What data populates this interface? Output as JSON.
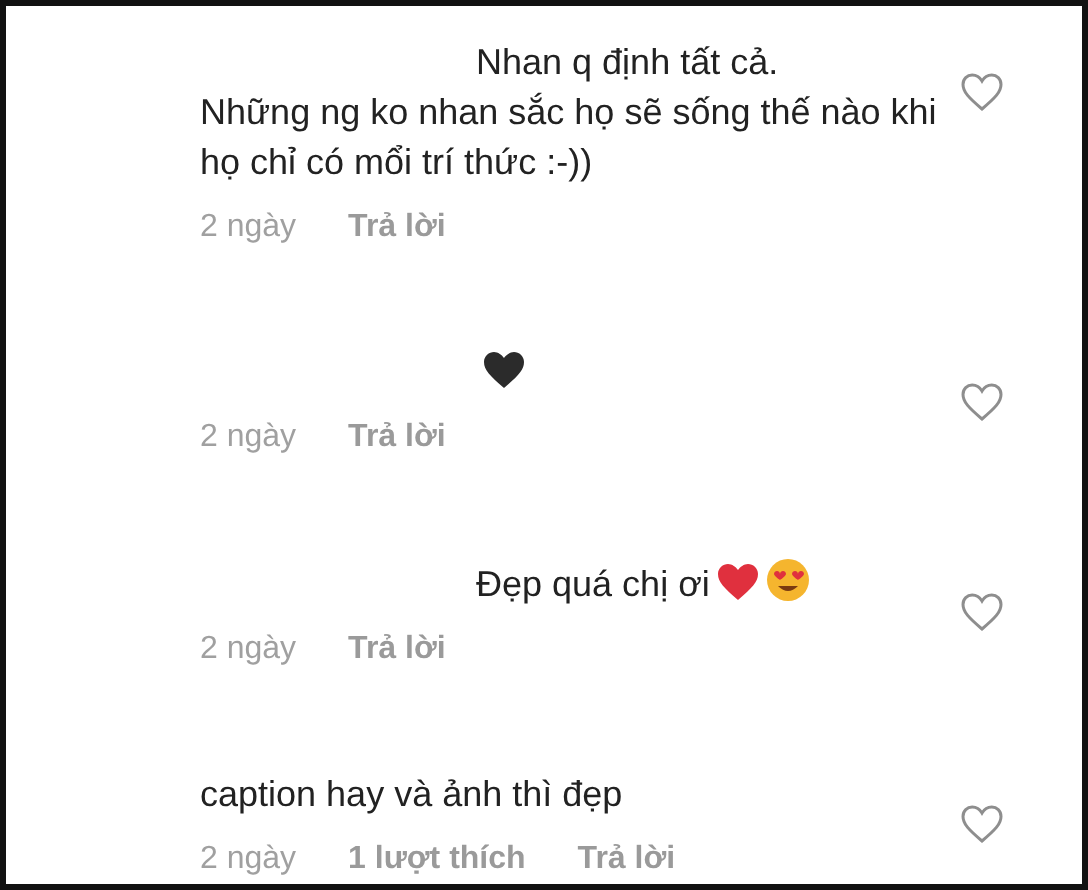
{
  "comments": [
    {
      "name_hidden": true,
      "text": "Nhan q định tất cả.\nNhững ng ko nhan sắc họ sẽ sống thế nào khi họ chỉ có mổi trí thức :-))",
      "time": "2 ngày",
      "reply": "Trả lời",
      "liked": false
    },
    {
      "name_hidden": true,
      "emojis": [
        {
          "kind": "heart",
          "color": "#2b2b2b"
        }
      ],
      "time": "2 ngày",
      "reply": "Trả lời",
      "liked": false
    },
    {
      "name_hidden": true,
      "text": "Đẹp quá chị ơi",
      "emojis": [
        {
          "kind": "heart",
          "color": "#e0303e"
        },
        {
          "kind": "heart-eyes-face",
          "color": "#f5b52e"
        }
      ],
      "time": "2 ngày",
      "reply": "Trả lời",
      "liked": false
    },
    {
      "name_hidden": false,
      "text": "caption hay và ảnh thì đẹp",
      "time": "2 ngày",
      "likes": "1 lượt thích",
      "reply": "Trả lời",
      "liked": false
    }
  ]
}
